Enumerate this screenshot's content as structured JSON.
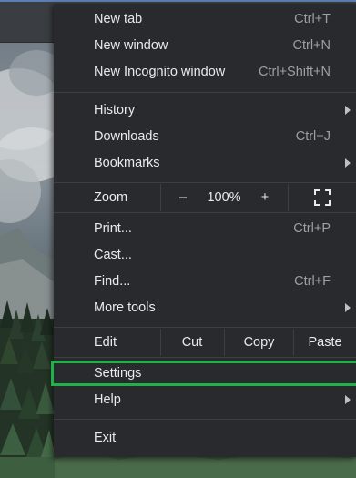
{
  "menu": {
    "new_tab": {
      "label": "New tab",
      "shortcut": "Ctrl+T"
    },
    "new_window": {
      "label": "New window",
      "shortcut": "Ctrl+N"
    },
    "new_incognito": {
      "label": "New Incognito window",
      "shortcut": "Ctrl+Shift+N"
    },
    "history": {
      "label": "History"
    },
    "downloads": {
      "label": "Downloads",
      "shortcut": "Ctrl+J"
    },
    "bookmarks": {
      "label": "Bookmarks"
    },
    "zoom": {
      "label": "Zoom",
      "minus": "–",
      "level": "100%",
      "plus": "+"
    },
    "print": {
      "label": "Print...",
      "shortcut": "Ctrl+P"
    },
    "cast": {
      "label": "Cast..."
    },
    "find": {
      "label": "Find...",
      "shortcut": "Ctrl+F"
    },
    "more_tools": {
      "label": "More tools"
    },
    "edit": {
      "label": "Edit",
      "cut": "Cut",
      "copy": "Copy",
      "paste": "Paste"
    },
    "settings": {
      "label": "Settings"
    },
    "help": {
      "label": "Help"
    },
    "exit": {
      "label": "Exit"
    }
  },
  "colors": {
    "menu_bg": "#292a2d",
    "text": "#e8eaed",
    "shortcut_text": "#9aa0a6",
    "separator": "#3c4043",
    "highlight": "#22b04a"
  },
  "icons": {
    "submenu": "chevron-right-icon",
    "fullscreen": "fullscreen-icon"
  }
}
